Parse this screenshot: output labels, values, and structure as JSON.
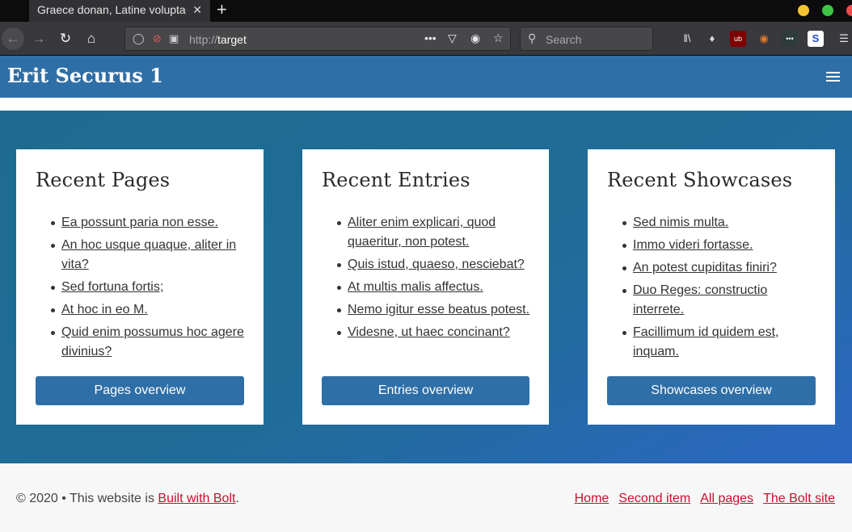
{
  "browser": {
    "tab_title": "Graece donan, Latine volupta",
    "tab_close": "✕",
    "new_tab": "+",
    "url_protocol": "http://",
    "url_host": "target",
    "search_placeholder": "Search"
  },
  "site": {
    "title": "Erit Securus 1"
  },
  "cards": [
    {
      "heading": "Recent Pages",
      "items": [
        "Ea possunt paria non esse.",
        "An hoc usque quaque, aliter in vita?",
        "Sed fortuna fortis;",
        "At hoc in eo M.",
        "Quid enim possumus hoc agere divinius?"
      ],
      "button": "Pages overview"
    },
    {
      "heading": "Recent Entries",
      "items": [
        "Aliter enim explicari, quod quaeritur, non potest.",
        "Quis istud, quaeso, nesciebat?",
        "At multis malis affectus.",
        "Nemo igitur esse beatus potest.",
        "Videsne, ut haec concinant?"
      ],
      "button": "Entries overview"
    },
    {
      "heading": "Recent Showcases",
      "items": [
        "Sed nimis multa.",
        "Immo videri fortasse.",
        "An potest cupiditas finiri?",
        "Duo Reges: constructio interrete.",
        "Facillimum id quidem est, inquam."
      ],
      "button": "Showcases overview"
    }
  ],
  "footer": {
    "copyright": "© 2020 • This website is ",
    "built_link": "Built with Bolt",
    "period": ".",
    "nav": [
      "Home",
      "Second item",
      "All pages",
      "The Bolt site"
    ]
  }
}
